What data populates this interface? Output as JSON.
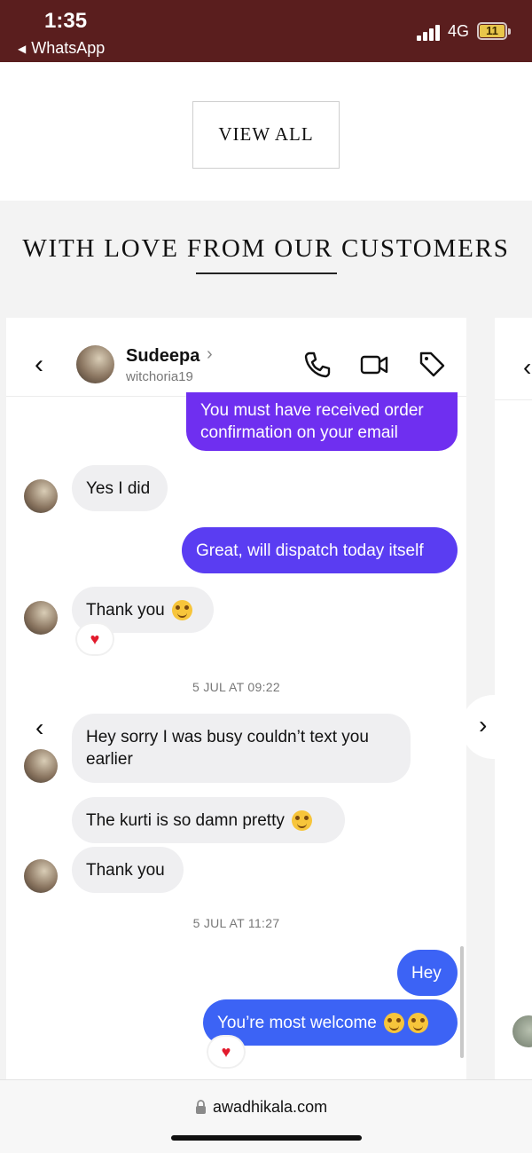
{
  "status_bar": {
    "time": "1:35",
    "back_app": "WhatsApp",
    "network": "4G",
    "battery": "11"
  },
  "view_all": {
    "label": "VIEW ALL"
  },
  "section": {
    "title": "WITH LOVE FROM OUR CUSTOMERS"
  },
  "chat": {
    "contact_name": "Sudeepa",
    "contact_handle": "witchoria19",
    "messages": [
      {
        "text": "You must have received order confirmation on your email",
        "side": "outgoing"
      },
      {
        "text": "Yes I did",
        "side": "incoming"
      },
      {
        "text": "Great, will dispatch today itself",
        "side": "outgoing"
      },
      {
        "text": "Thank you",
        "side": "incoming",
        "emoji": "star-struck-emoji",
        "reaction": "heart"
      },
      {
        "text": "Hey sorry I was busy couldn’t text you earlier",
        "side": "incoming"
      },
      {
        "text": "The kurti is so damn pretty",
        "side": "incoming",
        "emoji": "star-struck-emoji"
      },
      {
        "text": "Thank you",
        "side": "incoming"
      },
      {
        "text": "Hey",
        "side": "outgoing"
      },
      {
        "text": "You’re most welcome",
        "side": "outgoing",
        "emoji": "smiling-face-emoji",
        "reaction": "heart"
      }
    ],
    "timestamps": [
      "5 JUL AT 09:22",
      "5 JUL AT 11:27"
    ],
    "reaction_glyph": "♥"
  },
  "browser": {
    "url": "awadhikala.com"
  },
  "colors": {
    "status_bar": "#5a1e1e",
    "purple_bubble": "#6f2ff0",
    "blue_bubble": "#3c63f5",
    "incoming_bubble": "#efeff1"
  },
  "icons": [
    "back-chevron-icon",
    "phone-icon",
    "video-camera-icon",
    "tag-icon",
    "lock-icon"
  ]
}
